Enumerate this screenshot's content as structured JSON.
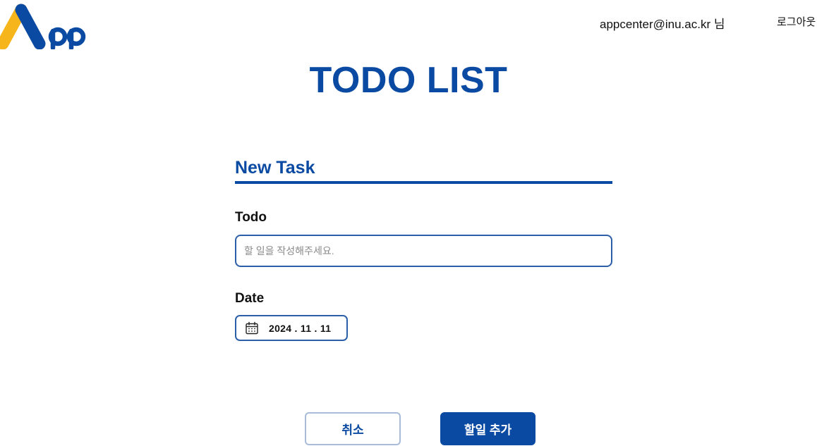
{
  "header": {
    "logo_text": "App",
    "user_email": "appcenter@inu.ac.kr 님",
    "logout_label": "로그아웃"
  },
  "main": {
    "title": "TODO LIST",
    "section_title": "New Task",
    "todo": {
      "label": "Todo",
      "placeholder": "할 일을 작성해주세요.",
      "value": ""
    },
    "date": {
      "label": "Date",
      "value": "2024 . 11 . 11",
      "icon": "calendar-icon"
    },
    "actions": {
      "cancel_label": "취소",
      "add_label": "할일 추가"
    }
  },
  "colors": {
    "brand_blue": "#0b4aa2",
    "logo_yellow": "#f7b51c",
    "border_blue": "#2b5fa8",
    "cancel_border": "#a8bcda"
  }
}
